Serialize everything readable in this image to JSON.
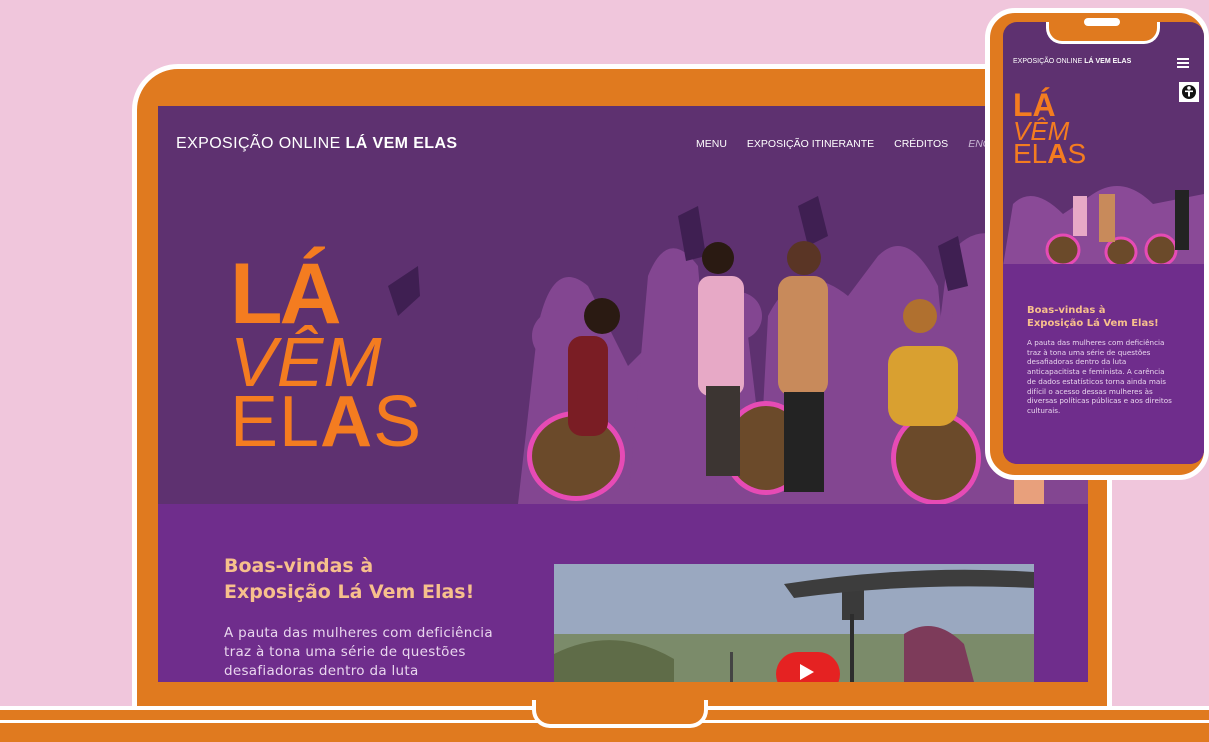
{
  "site": {
    "title_prefix": "EXPOSIÇÃO ONLINE",
    "title_bold": "LÁ VEM ELAS"
  },
  "nav": {
    "items": [
      "MENU",
      "EXPOSIÇÃO ITINERANTE",
      "CRÉDITOS"
    ],
    "language": "ENG"
  },
  "hero": {
    "logo_line1": "LÁ",
    "logo_line2": "VÊM",
    "logo_line3_part1": "EL",
    "logo_line3_part2": "A",
    "logo_line3_part3": "S"
  },
  "welcome": {
    "title": "Boas-vindas à\nExposição Lá Vem Elas!",
    "body_desktop": "A pauta das mulheres com deficiência traz à tona uma série de questões desafiadoras dentro da luta",
    "body_mobile": "A pauta das mulheres com deficiência traz à tona uma série de questões desafiadoras dentro da luta anticapacitista e feminista. A carência de dados estatísticos torna ainda mais difícil o acesso dessas mulheres às diversas políticas públicas e aos direitos culturais."
  },
  "colors": {
    "background": "#f0c6dc",
    "device_frame": "#e07a1f",
    "page_purple": "#5e3170",
    "section_purple": "#6f2d8c",
    "accent_orange": "#f47c20",
    "welcome_title": "#f7c08c",
    "youtube_red": "#e52222"
  },
  "icons": {
    "menu": "hamburger-menu-icon",
    "accessibility": "accessibility-icon",
    "video_play": "youtube-play-icon"
  }
}
